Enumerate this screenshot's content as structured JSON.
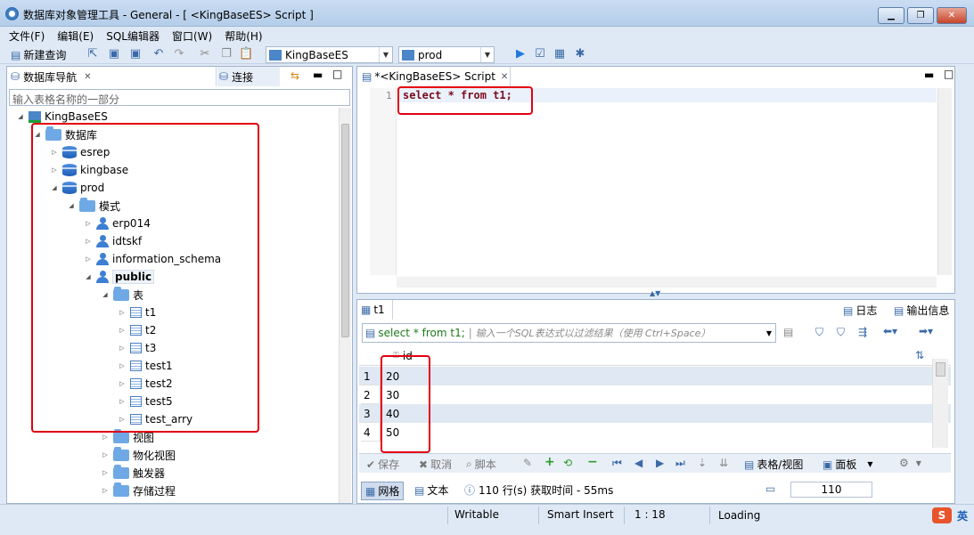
{
  "window": {
    "title": "数据库对象管理工具 - General - [ <KingBaseES> Script ]"
  },
  "menu": [
    "文件(F)",
    "编辑(E)",
    "SQL编辑器",
    "窗口(W)",
    "帮助(H)"
  ],
  "toolbar": {
    "new_query": "新建查询",
    "connection_combo": "KingBaseES",
    "db_combo": "prod"
  },
  "nav": {
    "tab_label": "数据库导航",
    "connect_label": "连接",
    "filter_placeholder": "输入表格名称的一部分",
    "tree": {
      "root": "KingBaseES",
      "databases": "数据库",
      "esrep": "esrep",
      "kingbase": "kingbase",
      "prod": "prod",
      "schemas": "模式",
      "erp014": "erp014",
      "idtskf": "idtskf",
      "information_schema": "information_schema",
      "public": "public",
      "tables": "表",
      "t1": "t1",
      "t2": "t2",
      "t3": "t3",
      "test1": "test1",
      "test2": "test2",
      "test5": "test5",
      "test_arry": "test_arry",
      "views": "视图",
      "mviews": "物化视图",
      "triggers": "触发器",
      "procedures": "存储过程"
    }
  },
  "editor": {
    "tab_label": "*<KingBaseES> Script",
    "line_no": "1",
    "sql": "select * from t1;"
  },
  "result": {
    "tab_label": "t1",
    "log_label": "日志",
    "output_label": "输出信息",
    "query_text": "select * from t1;",
    "filter_placeholder": "输入一个SQL表达式以过滤结果（使用 Ctrl+Space）",
    "column_header": "id",
    "rows": [
      {
        "n": "1",
        "v": "20"
      },
      {
        "n": "2",
        "v": "30"
      },
      {
        "n": "3",
        "v": "40"
      },
      {
        "n": "4",
        "v": "50"
      }
    ],
    "actions": {
      "save": "保存",
      "cancel": "取消",
      "script": "脚本",
      "table_view": "表格/视图",
      "panel": "面板"
    },
    "view_grid": "网格",
    "view_text": "文本",
    "info": "110 行(s)  获取时间 - 55ms",
    "count_box": "110"
  },
  "status": {
    "writable": "Writable",
    "insert": "Smart Insert",
    "pos": "1 : 18",
    "loading": "Loading",
    "ime": "英"
  }
}
